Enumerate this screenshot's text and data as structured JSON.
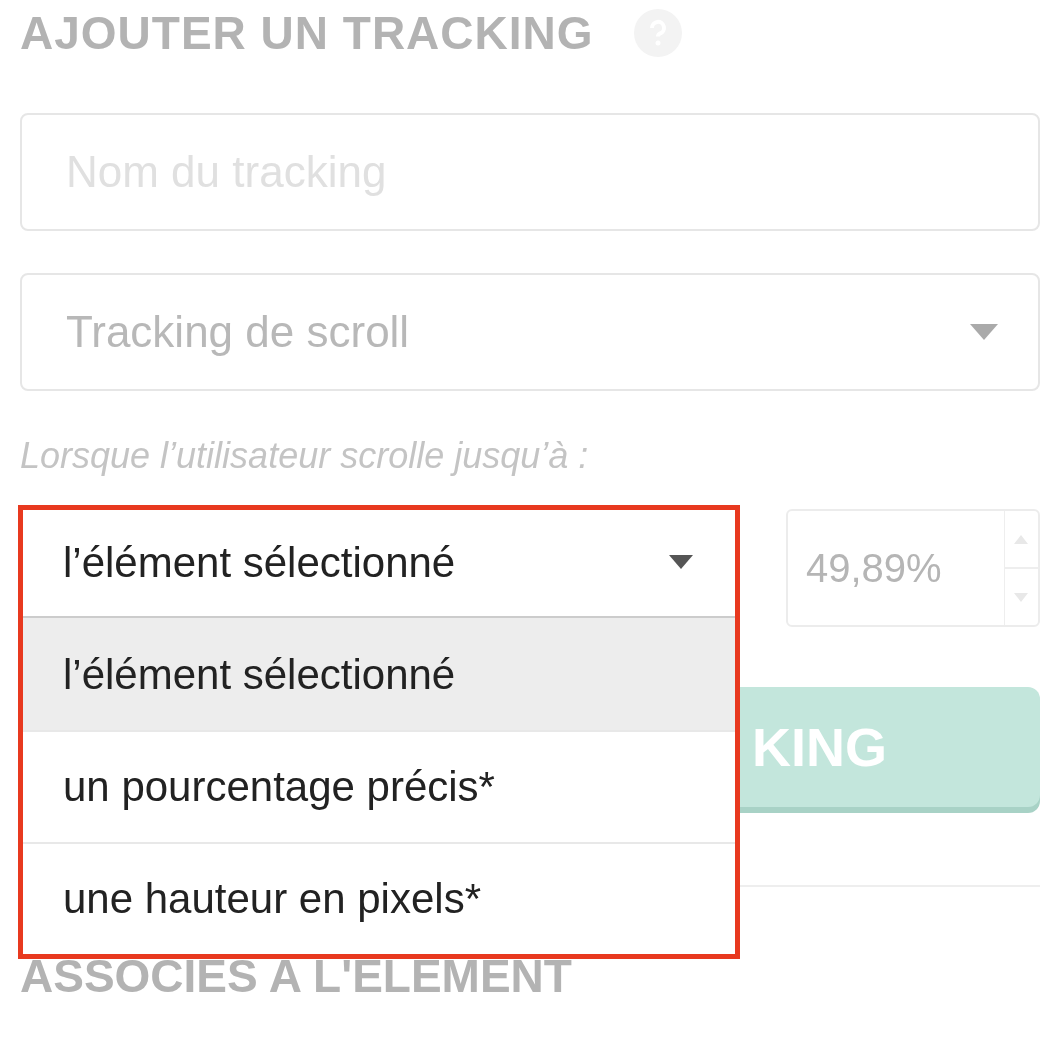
{
  "heading": {
    "title": "AJOUTER UN TRACKING"
  },
  "name_field": {
    "placeholder": "Nom du tracking"
  },
  "type_select": {
    "placeholder": "Tracking de scroll"
  },
  "scroll_label": "Lorsque l’utilisateur scrolle jusqu’à :",
  "scroll_target": {
    "value": "l’élément sélectionné",
    "expanded": true,
    "highlighted": true,
    "options": [
      {
        "label": "l’élément sélectionné",
        "selected": true
      },
      {
        "label": "un pourcentage précis*",
        "selected": false
      },
      {
        "label": "une hauteur en pixels*",
        "selected": false
      }
    ]
  },
  "percent_field": {
    "value": "49,89%",
    "disabled": true
  },
  "submit_button": {
    "label": "KING"
  },
  "section_title": "ASSOCIES A L'ELEMENT"
}
